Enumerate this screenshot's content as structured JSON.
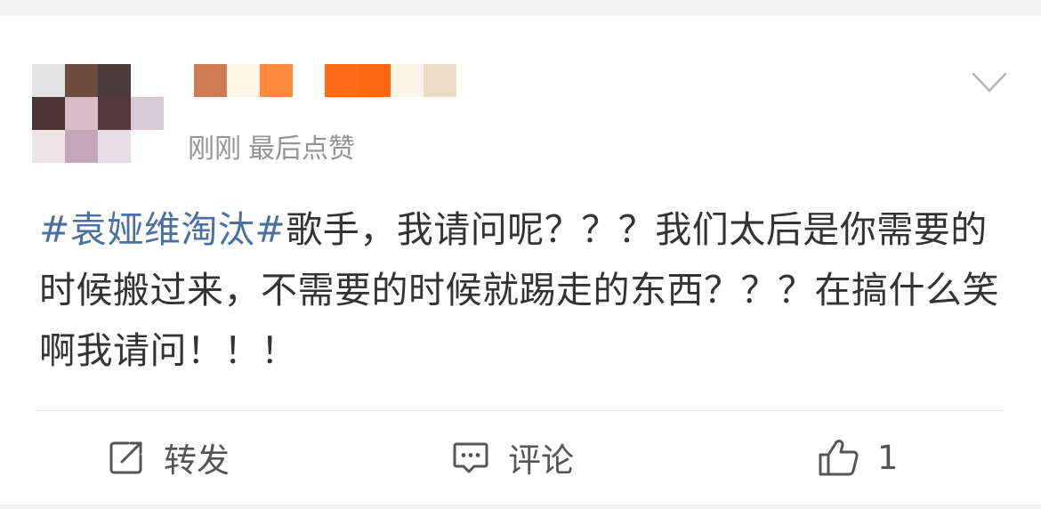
{
  "post": {
    "timestamp": "刚刚",
    "last_liked": "最后点赞",
    "hashtag": "#袁娅维淘汰#",
    "body": "歌手，我请问呢？？？我们太后是你需要的时候搬过来，不需要的时候就踢走的东西？？？在搞什么笑啊我请问！！！",
    "menu_icon": "chevron-down-icon"
  },
  "avatar": {
    "icon": "pixelated-avatar",
    "colors": [
      "#e3e3e3",
      "#6b4c3f",
      "#4a3b3a",
      "#ffffff",
      "#4b3433",
      "#d9bcc7",
      "#55393d",
      "#d8cad8",
      "#efe4e8",
      "#c3a7b8",
      "#e8dde4",
      "#ffffff"
    ]
  },
  "username": {
    "icon": "pixelated-username",
    "colors": [
      "#ce7c53",
      "#fdf6e8",
      "#ff8a3d",
      "#ffffff",
      "#ff6a1a",
      "#ff6610",
      "#fdf4e8",
      "#ecdcc6"
    ]
  },
  "actions": {
    "repost": {
      "label": "转发",
      "icon": "share-icon"
    },
    "comment": {
      "label": "评论",
      "icon": "comment-icon"
    },
    "like": {
      "label": "1",
      "icon": "thumbs-up-icon"
    }
  },
  "colors": {
    "hashtag": "#4a6fa5",
    "text": "#333333",
    "meta": "#939393",
    "icon": "#555555"
  }
}
